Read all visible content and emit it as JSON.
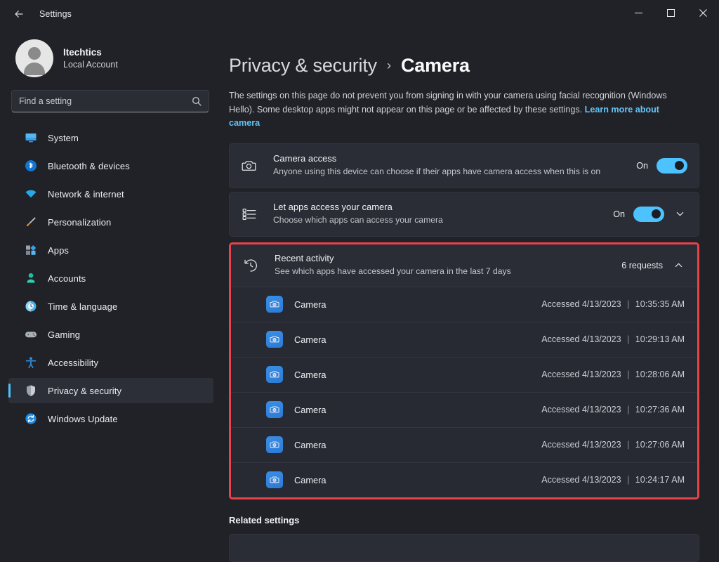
{
  "window": {
    "title": "Settings",
    "back_icon": "back-arrow-icon",
    "minimize_label": "Minimize",
    "maximize_label": "Maximize",
    "close_label": "Close"
  },
  "account": {
    "name": "Itechtics",
    "subtitle": "Local Account",
    "avatar_icon": "person-avatar-icon"
  },
  "search": {
    "placeholder": "Find a setting",
    "value": "",
    "icon": "search-icon"
  },
  "sidebar": {
    "items": [
      {
        "label": "System",
        "icon": "monitor-icon",
        "active": false
      },
      {
        "label": "Bluetooth & devices",
        "icon": "bluetooth-icon",
        "active": false
      },
      {
        "label": "Network & internet",
        "icon": "wifi-icon",
        "active": false
      },
      {
        "label": "Personalization",
        "icon": "paintbrush-icon",
        "active": false
      },
      {
        "label": "Apps",
        "icon": "apps-icon",
        "active": false
      },
      {
        "label": "Accounts",
        "icon": "account-icon",
        "active": false
      },
      {
        "label": "Time & language",
        "icon": "clock-globe-icon",
        "active": false
      },
      {
        "label": "Gaming",
        "icon": "gamepad-icon",
        "active": false
      },
      {
        "label": "Accessibility",
        "icon": "accessibility-icon",
        "active": false
      },
      {
        "label": "Privacy & security",
        "icon": "shield-icon",
        "active": true
      },
      {
        "label": "Windows Update",
        "icon": "update-refresh-icon",
        "active": false
      }
    ]
  },
  "breadcrumb": {
    "parent": "Privacy & security",
    "separator": "›",
    "current": "Camera"
  },
  "description": {
    "text": "The settings on this page do not prevent you from signing in with your camera using facial recognition (Windows Hello). Some desktop apps might not appear on this page or be affected by these settings. ",
    "link": "Learn more about camera"
  },
  "cards": {
    "camera_access": {
      "icon": "camera-icon",
      "title": "Camera access",
      "subtitle": "Anyone using this device can choose if their apps have camera access when this is on",
      "toggle_label": "On",
      "toggle_state": "on"
    },
    "let_apps": {
      "icon": "app-list-icon",
      "title": "Let apps access your camera",
      "subtitle": "Choose which apps can access your camera",
      "toggle_label": "On",
      "toggle_state": "on",
      "expand_icon": "chevron-down-icon"
    }
  },
  "recent_activity": {
    "icon": "history-clock-icon",
    "title": "Recent activity",
    "subtitle": "See which apps have accessed your camera in the last 7 days",
    "count_label": "6 requests",
    "expand_icon": "chevron-up-icon",
    "expanded": true,
    "highlight_color": "#e8434a",
    "rows": [
      {
        "app": "Camera",
        "icon": "camera-app-icon",
        "prefix": "Accessed",
        "date": "4/13/2023",
        "time": "10:35:35 AM"
      },
      {
        "app": "Camera",
        "icon": "camera-app-icon",
        "prefix": "Accessed",
        "date": "4/13/2023",
        "time": "10:29:13 AM"
      },
      {
        "app": "Camera",
        "icon": "camera-app-icon",
        "prefix": "Accessed",
        "date": "4/13/2023",
        "time": "10:28:06 AM"
      },
      {
        "app": "Camera",
        "icon": "camera-app-icon",
        "prefix": "Accessed",
        "date": "4/13/2023",
        "time": "10:27:36 AM"
      },
      {
        "app": "Camera",
        "icon": "camera-app-icon",
        "prefix": "Accessed",
        "date": "4/13/2023",
        "time": "10:27:06 AM"
      },
      {
        "app": "Camera",
        "icon": "camera-app-icon",
        "prefix": "Accessed",
        "date": "4/13/2023",
        "time": "10:24:17 AM"
      }
    ]
  },
  "related": {
    "title": "Related settings"
  },
  "colors": {
    "accent": "#4cc2ff",
    "highlight": "#e8434a",
    "window_bg": "#202227",
    "card_bg": "#2a2d35",
    "link": "#62c5f7"
  }
}
